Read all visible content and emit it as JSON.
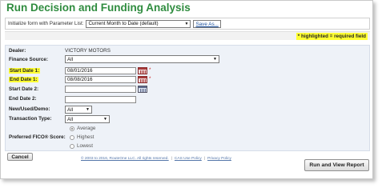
{
  "page": {
    "title": "Run Decision and Funding Analysis"
  },
  "params": {
    "label": "Initialize form with Parameter List:",
    "selected": "Current Month to Date (default)",
    "save_label": "Save As..."
  },
  "required_note": "* highlighted = required field",
  "form": {
    "dealer": {
      "label": "Dealer:",
      "value": "VICTORY MOTORS"
    },
    "finance_source": {
      "label": "Finance Source:",
      "value": "All"
    },
    "start_date_1": {
      "label": "Start Date 1:",
      "value": "08/01/2016",
      "required_mark": "*"
    },
    "end_date_1": {
      "label": "End Date 1:",
      "value": "08/08/2016",
      "required_mark": "*"
    },
    "start_date_2": {
      "label": "Start Date 2:",
      "value": ""
    },
    "end_date_2": {
      "label": "End Date 2:",
      "value": ""
    },
    "new_used_demo": {
      "label": "New/Used/Demo:",
      "value": "All"
    },
    "transaction_type": {
      "label": "Transaction Type:",
      "value": "All"
    },
    "fico": {
      "label": "Preferred FICO® Score:",
      "options": [
        "Average",
        "Highest",
        "Lowest"
      ],
      "selected": "Average"
    }
  },
  "buttons": {
    "cancel": "Cancel",
    "run": "Run and View Report"
  },
  "footer": {
    "copyright": "© 2003 to 2016, RouteOne LLC. All rights reserved.",
    "sep": "|",
    "use_policy": "CAS Use Policy",
    "privacy": "Privacy Policy"
  },
  "colors": {
    "title": "#2f8c3f",
    "highlight": "#ffff33",
    "panel": "#eef2f8",
    "link": "#1a4f9c"
  }
}
